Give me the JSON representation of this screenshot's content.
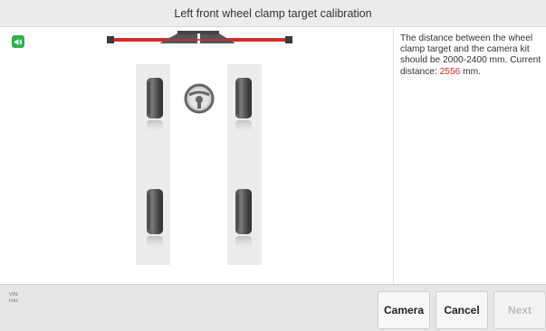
{
  "header": {
    "title": "Left front wheel clamp target calibration"
  },
  "instructions": {
    "text_before": "The distance between the wheel clamp target and the camera kit should be 2000-2400 mm. Current distance: ",
    "current_distance": "2556",
    "text_after": " mm.",
    "highlight_color": "#e02020"
  },
  "footer": {
    "vin_label": "VIN:",
    "info_label": "Info:",
    "buttons": {
      "camera": "Camera",
      "cancel": "Cancel",
      "next": "Next"
    }
  },
  "colors": {
    "sound_icon": "#2eb34a",
    "camera_bar_red": "#d62b2b"
  },
  "icons": {
    "sound": "speaker-icon"
  }
}
